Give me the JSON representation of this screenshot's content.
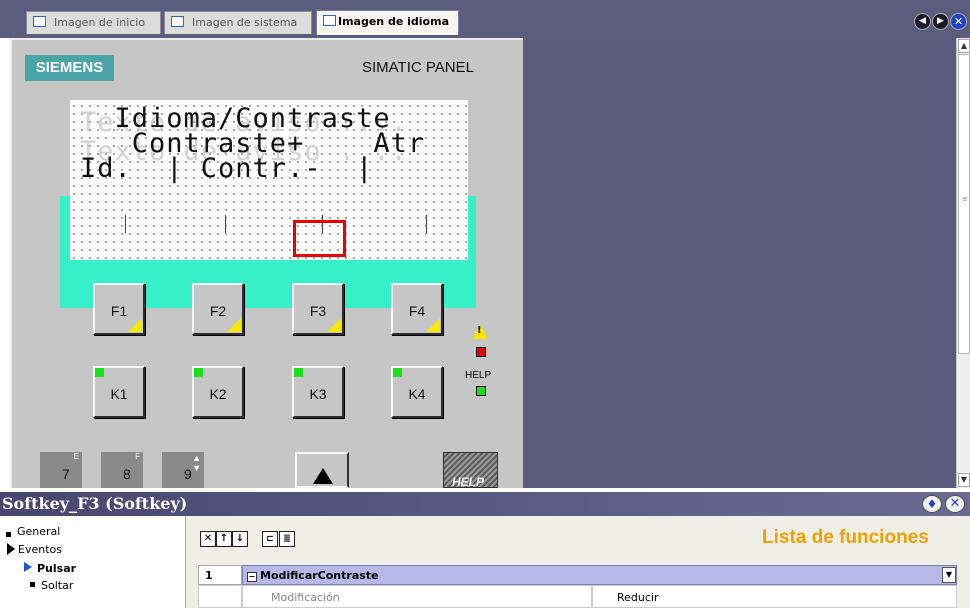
{
  "tabs": [
    {
      "label": "Imagen de inicio"
    },
    {
      "label": "Imagen de sistema"
    },
    {
      "label": "Imagen de idioma"
    }
  ],
  "nav": {
    "prev_icon": "◀",
    "next_icon": "▶",
    "close_icon": "✕"
  },
  "panel": {
    "brand": "SIEMENS",
    "model": "SIMATIC PANEL",
    "screen": {
      "ghost_lines": "Texto de aviso ....\nTexto de aviso ....",
      "text_lines": "  Idioma/Contraste\n   Contraste+    Atr\nId.  | Contr.-  |"
    },
    "function_keys": [
      "F1",
      "F2",
      "F3",
      "F4"
    ],
    "k_keys": [
      "K1",
      "K2",
      "K3",
      "K4"
    ],
    "help_label": "HELP",
    "num_keys": [
      {
        "num": "7",
        "sup": "E"
      },
      {
        "num": "8",
        "sup": "F"
      },
      {
        "num": "9",
        "sup": ""
      }
    ],
    "help_key_label": "HELP"
  },
  "properties": {
    "title": "Softkey_F3 (Softkey)",
    "tree": {
      "general": "General",
      "eventos": "Eventos",
      "pulsar": "Pulsar",
      "soltar": "Soltar"
    },
    "toolbar": {
      "delete": "✕",
      "up": "↑",
      "down": "↓"
    },
    "list_title": "Lista de funciones",
    "function_row": {
      "num": "1",
      "name": "ModificarContraste"
    },
    "param_row": {
      "name": "Modificación",
      "value": "Reducir"
    }
  },
  "colors": {
    "workspace": "#5b5b7d",
    "screen_bg": "#36f0c8",
    "accent_orange": "#f0a000",
    "selection_red": "#e80000"
  }
}
